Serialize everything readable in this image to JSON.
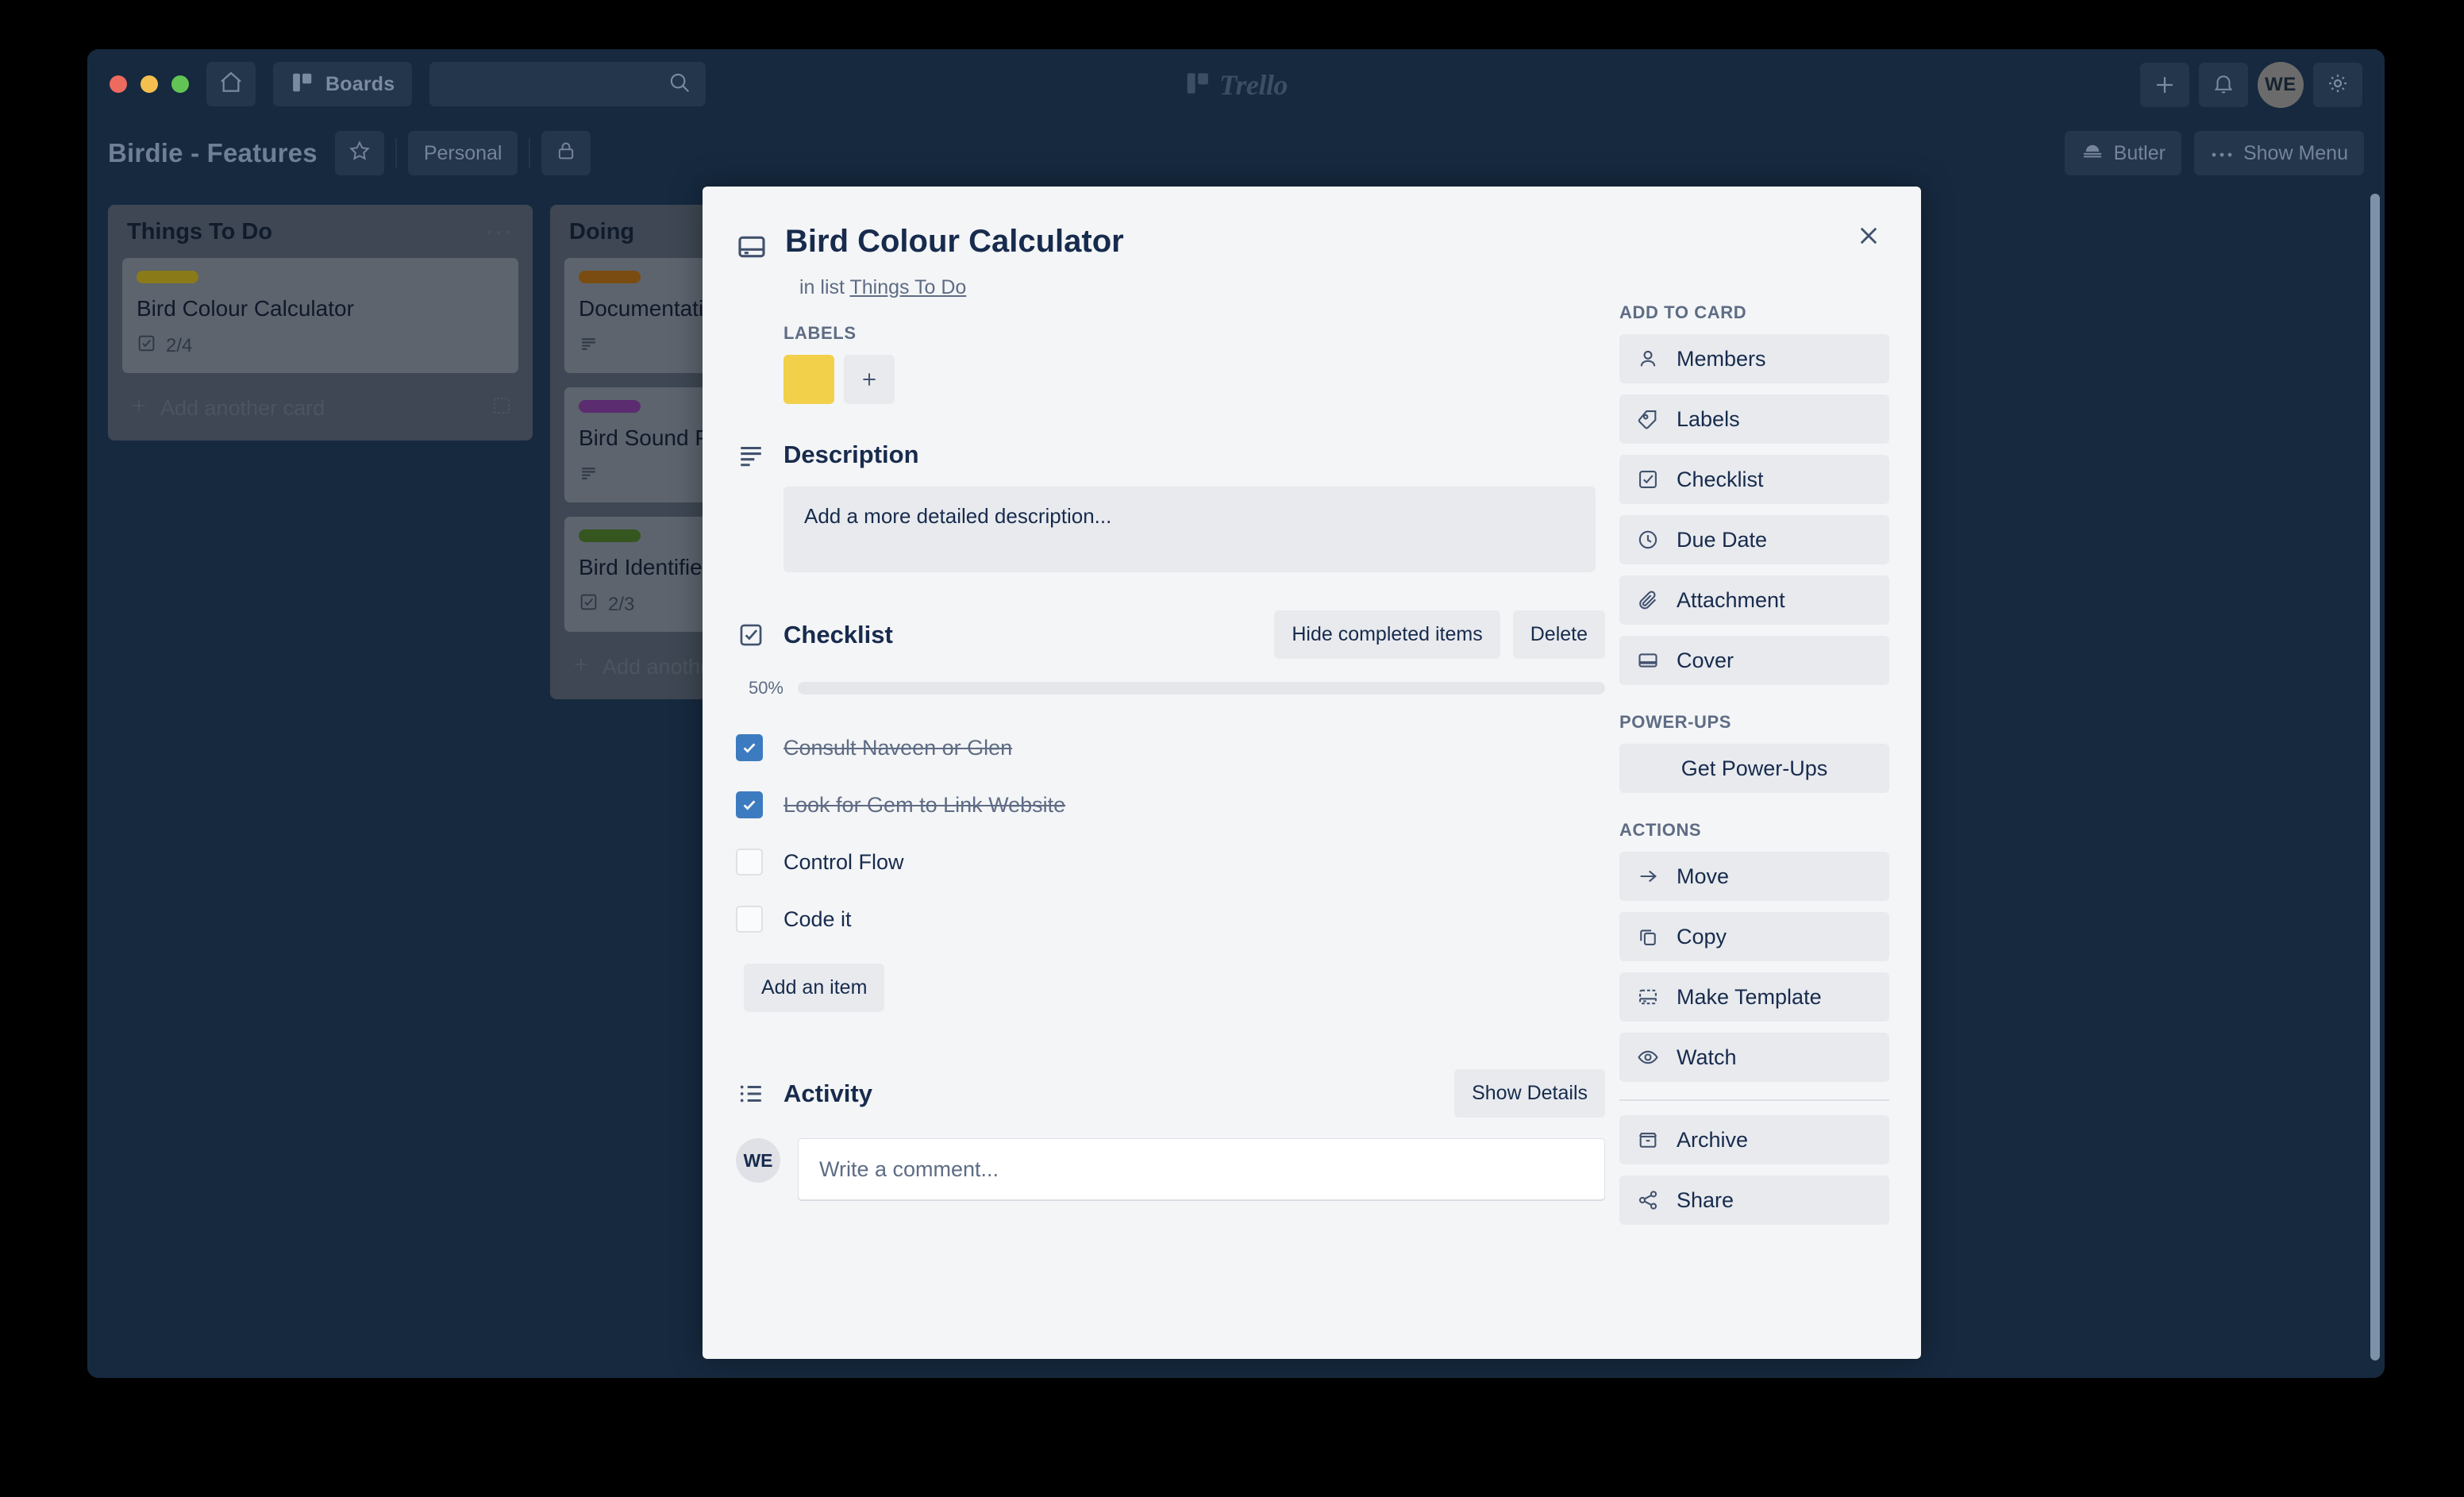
{
  "window": {
    "traffic_lights": [
      "close",
      "minimize",
      "maximize"
    ],
    "home_icon": "home-icon",
    "boards_label": "Boards",
    "boards_icon": "board-icon",
    "search_icon": "search-icon",
    "search_placeholder": "",
    "logo_text": "Trello",
    "logo_icon": "trello-board-icon",
    "plus_icon": "plus-icon",
    "bell_icon": "bell-icon",
    "gear_icon": "gear-icon",
    "avatar_initials": "WE"
  },
  "board_header": {
    "title": "Birdie - Features",
    "star_icon": "star-icon",
    "visibility_label": "Personal",
    "lock_icon": "lock-icon",
    "butler_label": "Butler",
    "butler_icon": "butler-bell-icon",
    "show_menu_label": "Show Menu",
    "show_menu_icon": "ellipsis-icon"
  },
  "board": {
    "lists": [
      {
        "title": "Things To Do",
        "menu_icon": "ellipsis-icon",
        "cards": [
          {
            "label_color": "#8a7b18",
            "title": "Bird Colour Calculator",
            "badge_icon": "checklist-icon",
            "badge_text": "2/4"
          }
        ],
        "add_card_label": "Add another card",
        "add_card_icon": "plus-icon",
        "template_icon": "card-template-icon"
      },
      {
        "title": "Doing",
        "menu_icon": "ellipsis-icon",
        "cards": [
          {
            "label_color": "#7a4c11",
            "title": "Documentation",
            "badge_icon": "description-icon",
            "badge_text": ""
          },
          {
            "label_color": "#5b2d70",
            "title": "Bird Sound Player",
            "badge_icon": "description-icon",
            "badge_text": ""
          },
          {
            "label_color": "#35571f",
            "title": "Bird Identifier",
            "badge_icon": "checklist-icon",
            "badge_text": "2/3"
          }
        ],
        "add_card_label": "Add another card",
        "add_card_icon": "plus-icon",
        "template_icon": "card-template-icon"
      }
    ]
  },
  "modal": {
    "close_icon": "close-icon",
    "cover_icon": "card-cover-icon",
    "title": "Bird Colour Calculator",
    "in_list_prefix": "in list",
    "in_list_name": "Things To Do",
    "labels": {
      "caption": "LABELS",
      "chips": [
        {
          "color": "#f2d049"
        }
      ],
      "add_icon": "plus-icon"
    },
    "description": {
      "icon": "description-icon",
      "title": "Description",
      "placeholder": "Add a more detailed description..."
    },
    "checklist": {
      "icon": "checklist-icon",
      "title": "Checklist",
      "hide_completed_label": "Hide completed items",
      "delete_label": "Delete",
      "percent_label": "50%",
      "percent_value": 50,
      "items": [
        {
          "text": "Consult Naveen or Glen",
          "checked": true
        },
        {
          "text": "Look for Gem to Link Website",
          "checked": true
        },
        {
          "text": "Control Flow",
          "checked": false
        },
        {
          "text": "Code it",
          "checked": false
        }
      ],
      "add_item_label": "Add an item"
    },
    "activity": {
      "icon": "activity-list-icon",
      "title": "Activity",
      "show_details_label": "Show Details",
      "avatar_initials": "WE",
      "comment_placeholder": "Write a comment..."
    },
    "sidebar": {
      "add_to_card_caption": "ADD TO CARD",
      "add_to_card_items": [
        {
          "label": "Members",
          "icon": "member-icon"
        },
        {
          "label": "Labels",
          "icon": "label-tag-icon"
        },
        {
          "label": "Checklist",
          "icon": "checklist-icon"
        },
        {
          "label": "Due Date",
          "icon": "clock-icon"
        },
        {
          "label": "Attachment",
          "icon": "paperclip-icon"
        },
        {
          "label": "Cover",
          "icon": "cover-icon"
        }
      ],
      "powerups_caption": "POWER-UPS",
      "get_powerups_label": "Get Power-Ups",
      "actions_caption": "ACTIONS",
      "action_items": [
        {
          "label": "Move",
          "icon": "arrow-right-icon"
        },
        {
          "label": "Copy",
          "icon": "copy-icon"
        },
        {
          "label": "Make Template",
          "icon": "template-icon"
        },
        {
          "label": "Watch",
          "icon": "eye-icon"
        }
      ],
      "bottom_items": [
        {
          "label": "Archive",
          "icon": "archive-icon"
        },
        {
          "label": "Share",
          "icon": "share-icon"
        }
      ]
    }
  },
  "colors": {
    "board_bg": "#16293f",
    "modal_bg": "#f4f5f7",
    "accent_blue": "#3d7bc0",
    "progress_blue": "#6aa3ce",
    "text_dark": "#172b4d",
    "text_muted": "#5e6c84"
  }
}
